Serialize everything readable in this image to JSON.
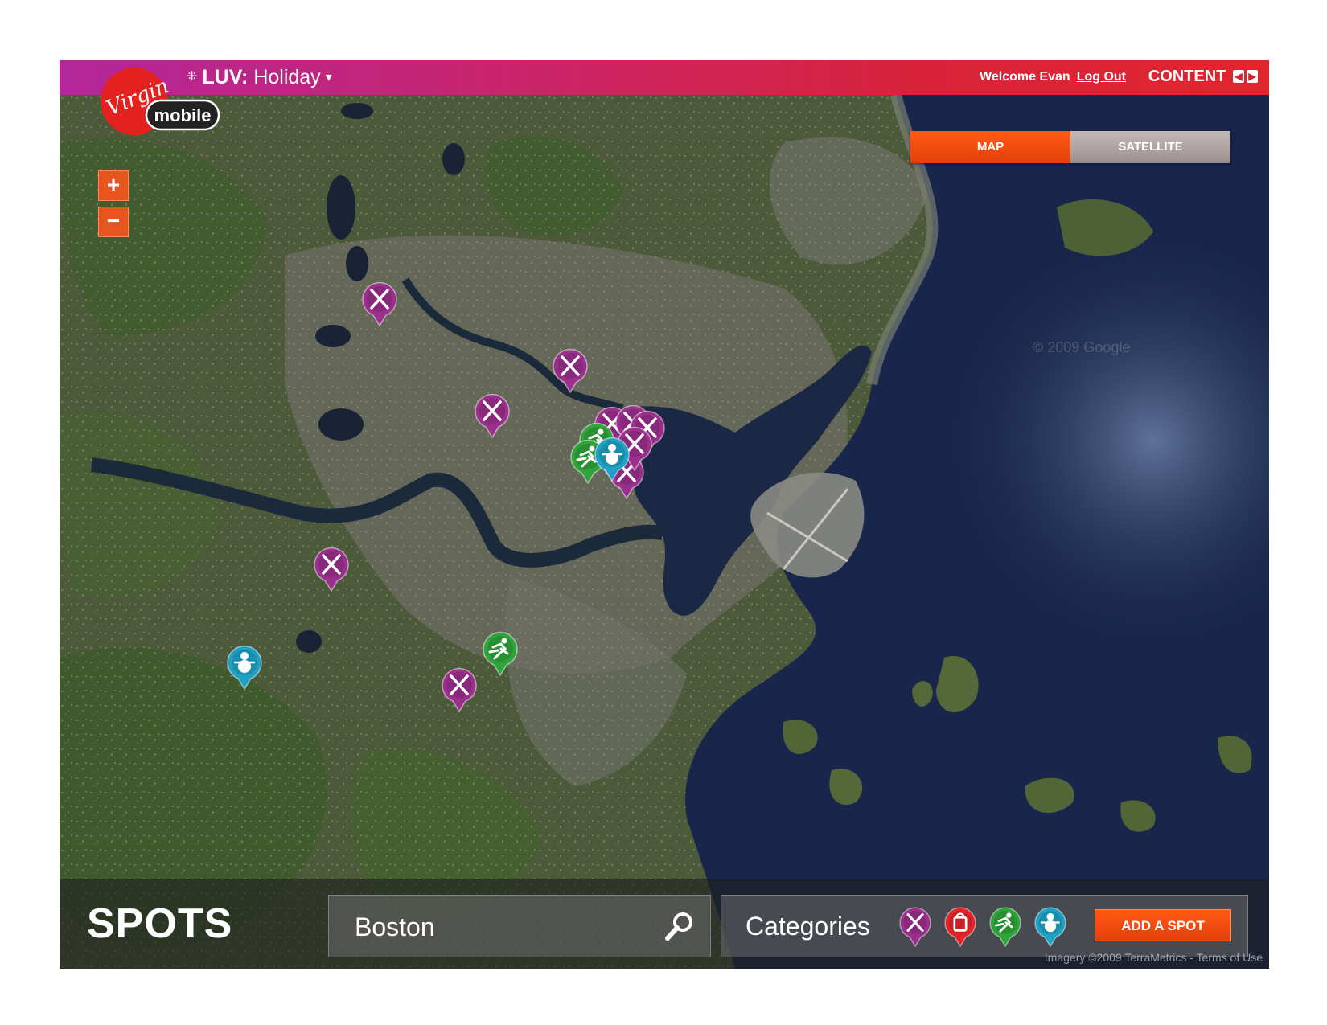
{
  "header": {
    "app_prefix": "LUV:",
    "app_name": "Holiday",
    "welcome_text": "Welcome Evan",
    "logout_label": "Log Out",
    "content_label": "CONTENT"
  },
  "logo": {
    "line1": "Virgin",
    "line2": "mobile"
  },
  "map": {
    "toggle": {
      "map_label": "MAP",
      "satellite_label": "SATELLITE",
      "active": "MAP"
    },
    "zoom_in": "+",
    "zoom_out": "−",
    "copyright": "Imagery ©2009 TerraMetrics - Terms of Use"
  },
  "pin_types": {
    "dining": {
      "color": "#9b2f8c",
      "icon": "fork-knife-icon"
    },
    "shopping": {
      "color": "#e32428",
      "icon": "shopping-bag-icon"
    },
    "activity": {
      "color": "#2ea43a",
      "icon": "skater-icon"
    },
    "winter": {
      "color": "#1ea1c4",
      "icon": "snowman-icon"
    }
  },
  "bottom": {
    "title": "SPOTS",
    "search_value": "Boston",
    "categories_label": "Categories",
    "categories": [
      "dining",
      "shopping",
      "activity",
      "winter"
    ],
    "add_spot_label": "ADD A SPOT"
  },
  "colors": {
    "accent": "#e84a15",
    "header_start": "#b2279a",
    "header_end": "#e0262c"
  }
}
